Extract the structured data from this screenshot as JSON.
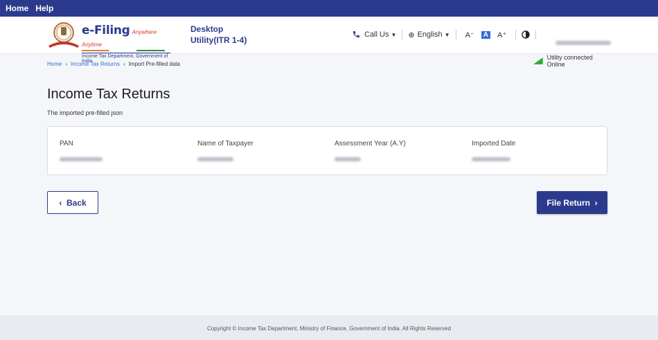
{
  "topnav": {
    "items": [
      {
        "label": "Home"
      },
      {
        "label": "Help"
      }
    ]
  },
  "header": {
    "brand_name": "e-Filing",
    "brand_tagline": "Anywhere Anytime",
    "brand_dept": "Income Tax Department, Government of India",
    "product_line1": "Desktop",
    "product_line2": "Utility(ITR 1-4)",
    "call_us": "Call Us",
    "language": "English",
    "font_decrease": "A⁻",
    "font_default": "A",
    "font_increase": "A⁺",
    "utility_status": "Utility connected Online"
  },
  "breadcrumb": {
    "items": [
      {
        "label": "Home"
      },
      {
        "label": "Income Tax Returns"
      },
      {
        "label": "Import Pre-filled data"
      }
    ]
  },
  "page": {
    "title": "Income Tax Returns",
    "subtitle": "The imported pre-filled json"
  },
  "details": {
    "columns": [
      {
        "label": "PAN"
      },
      {
        "label": "Name of Taxpayer"
      },
      {
        "label": "Assessment Year (A.Y)"
      },
      {
        "label": "Imported Date"
      }
    ]
  },
  "actions": {
    "back_label": "Back",
    "file_label": "File Return"
  },
  "footer": {
    "copyright": "Copyright © Income Tax Department, Ministry of Finance, Government of India. All Rights Reserved"
  },
  "colors": {
    "primary": "#2b3a8c",
    "link": "#2f6fd8",
    "online": "#2eab2e"
  }
}
